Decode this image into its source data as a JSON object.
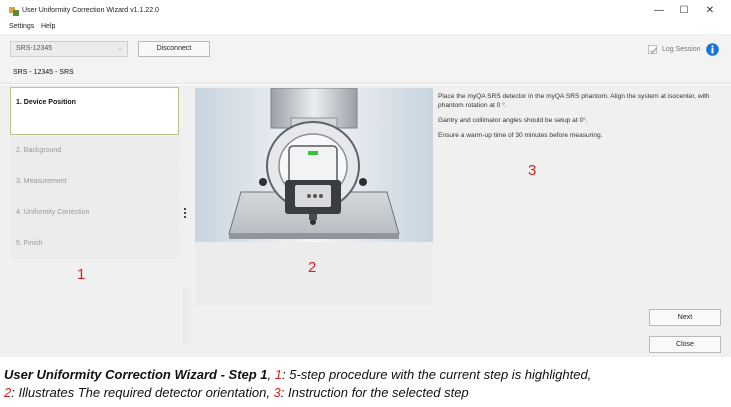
{
  "window": {
    "title": "User Uniformity Correction Wizard v1.1.22.0",
    "controls": [
      "—",
      "☐",
      "✕"
    ]
  },
  "menu": [
    "Settings",
    "Help"
  ],
  "toolbar": {
    "device_value": "SRS-12345",
    "disconnect_label": "Disconnect",
    "log_session_label": "Log Session",
    "log_session_checked": true
  },
  "breadcrumb": "SRS - 12345 - SRS",
  "steps": [
    {
      "label": "1. Device Position",
      "active": true
    },
    {
      "label": "2. Background",
      "active": false
    },
    {
      "label": "3. Measurement",
      "active": false
    },
    {
      "label": "4. Uniformity Correction",
      "active": false
    },
    {
      "label": "5. Finish",
      "active": false
    }
  ],
  "instructions": [
    "Place the myQA SRS detector in the myQA SRS phantom. Align the system at isocenter, with phantom rotation at 0 °.",
    "Gantry and collimator angles should be setup at 0°.",
    "Ensure a warm-up time of 30 minutes before measuring."
  ],
  "buttons": {
    "next": "Next",
    "close": "Close"
  },
  "markers": {
    "steps": "1",
    "image": "2",
    "instructions": "3"
  },
  "caption": {
    "title": "User Uniformity Correction Wizard - Step 1",
    "sep1": ", ",
    "n1": "1",
    "t1": ": 5-step procedure with the current step is highlighted,",
    "n2": "2",
    "t2": ": Illustrates The required detector orientation, ",
    "n3": "3",
    "t3": ": Instruction for the selected step"
  },
  "colors": {
    "marker_red": "#e02020",
    "active_step_border": "#b8c58a",
    "info_blue": "#1a73d9",
    "status_led_green": "#36c23a"
  }
}
